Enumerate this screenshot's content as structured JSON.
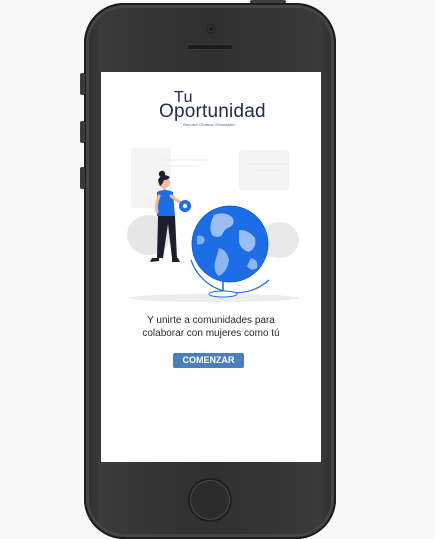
{
  "app": {
    "logo": {
      "line1": "Tu",
      "line2": "Oportunidad",
      "tagline": "Second Chance Education"
    }
  },
  "onboarding": {
    "message_line1": "Y unirte a comunidades para",
    "message_line2": "colaborar con mujeres como tú",
    "cta_label": "COMENZAR",
    "illustration": "woman-with-globe-illustration"
  },
  "colors": {
    "brand_dark": "#1d2b4d",
    "accent_blue": "#1d6de6",
    "button_blue": "#4a7fb8",
    "device_body": "#303030",
    "screen_bg": "#ffffff",
    "page_bg": "#f8f8f8"
  },
  "device": {
    "type": "smartphone-mockup"
  }
}
